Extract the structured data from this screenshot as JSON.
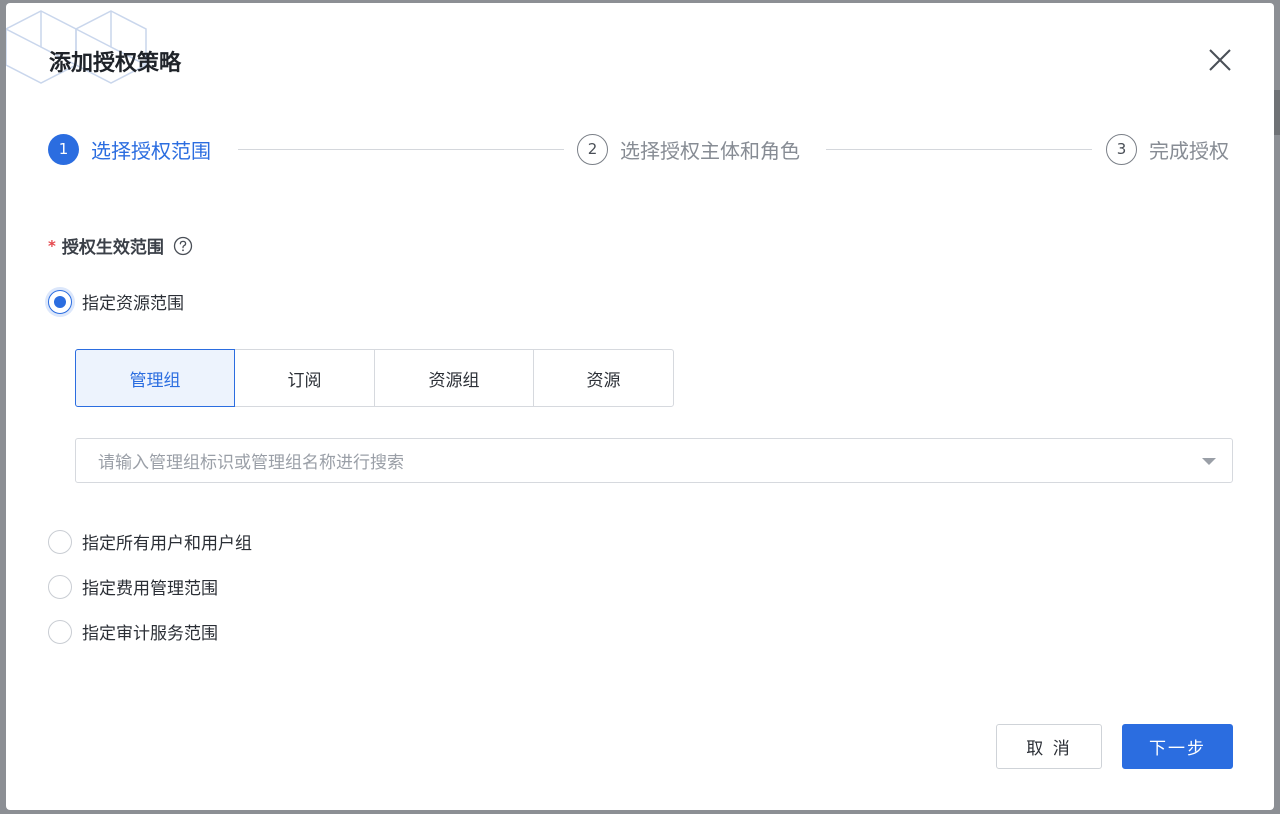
{
  "dialog": {
    "title": "添加授权策略"
  },
  "steps": [
    {
      "number": "1",
      "label": "选择授权范围",
      "state": "active"
    },
    {
      "number": "2",
      "label": "选择授权主体和角色",
      "state": "idle"
    },
    {
      "number": "3",
      "label": "完成授权",
      "state": "idle"
    }
  ],
  "form": {
    "required_mark": "*",
    "scope_label": "授权生效范围",
    "options": [
      {
        "label": "指定资源范围",
        "checked": true
      },
      {
        "label": "指定所有用户和用户组",
        "checked": false
      },
      {
        "label": "指定费用管理范围",
        "checked": false
      },
      {
        "label": "指定审计服务范围",
        "checked": false
      }
    ],
    "resource_tabs": [
      {
        "label": "管理组",
        "active": true
      },
      {
        "label": "订阅",
        "active": false
      },
      {
        "label": "资源组",
        "active": false
      },
      {
        "label": "资源",
        "active": false
      }
    ],
    "search": {
      "placeholder": "请输入管理组标识或管理组名称进行搜索"
    }
  },
  "footer": {
    "cancel_label": "取 消",
    "next_label": "下一步"
  },
  "colors": {
    "primary": "#2b6de0",
    "required": "#e5484d",
    "overlay": "#8c8f94"
  },
  "icons": {
    "close": "close-icon",
    "help": "question-circle-icon",
    "dropdown": "caret-down-icon"
  }
}
